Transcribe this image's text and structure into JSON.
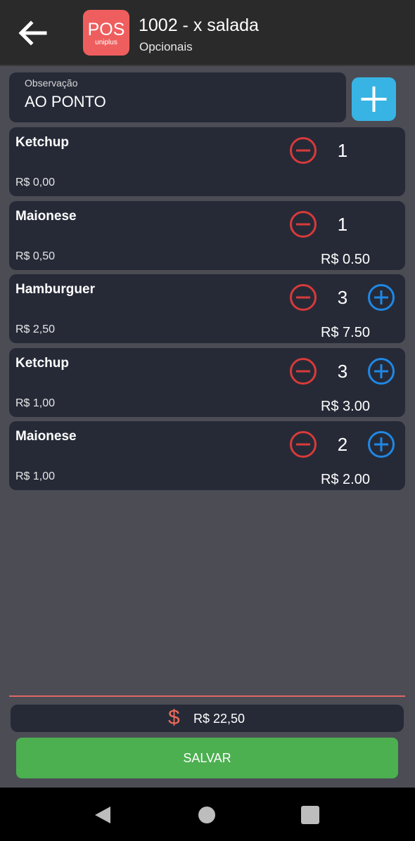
{
  "header": {
    "logo_text": "POS",
    "logo_sub": "uniplus",
    "title": "1002 - x salada",
    "subtitle": "Opcionais"
  },
  "observation": {
    "label": "Observação",
    "value": "AO PONTO"
  },
  "items": [
    {
      "name": "Ketchup",
      "price": "R$ 0,00",
      "qty": "1",
      "total": "",
      "has_plus": false
    },
    {
      "name": "Maionese",
      "price": "R$ 0,50",
      "qty": "1",
      "total": "R$ 0.50",
      "has_plus": false
    },
    {
      "name": "Hamburguer",
      "price": "R$ 2,50",
      "qty": "3",
      "total": "R$ 7.50",
      "has_plus": true
    },
    {
      "name": "Ketchup",
      "price": "R$ 1,00",
      "qty": "3",
      "total": "R$ 3.00",
      "has_plus": true
    },
    {
      "name": "Maionese",
      "price": "R$ 1,00",
      "qty": "2",
      "total": "R$ 2.00",
      "has_plus": true
    }
  ],
  "footer": {
    "currency_symbol": "$",
    "total": "R$ 22,50",
    "save_label": "SALVAR"
  },
  "colors": {
    "accent_red": "#d93a3a",
    "accent_blue": "#1f88e5",
    "save_green": "#4caf50",
    "add_button": "#38b4e4"
  }
}
